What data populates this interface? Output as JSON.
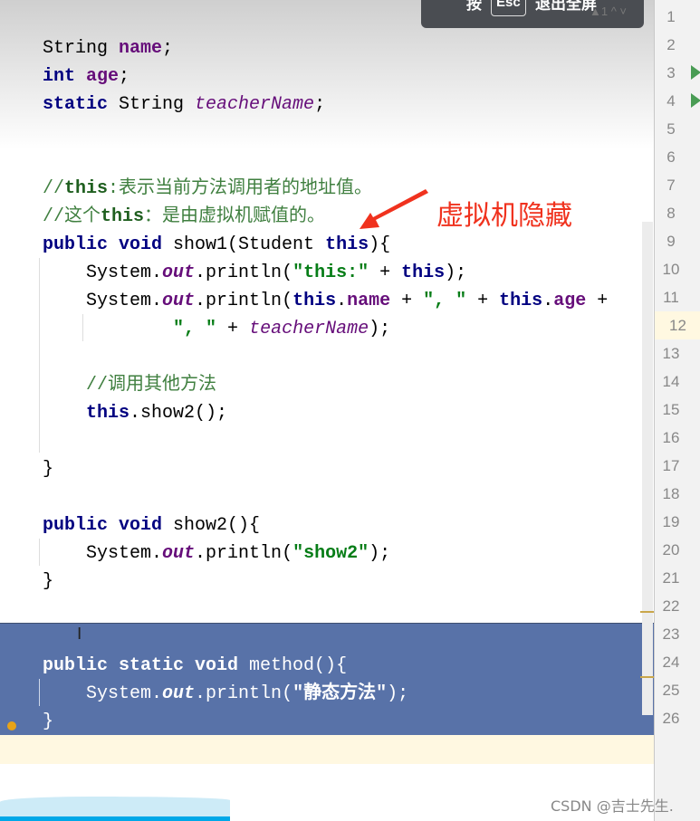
{
  "toast": {
    "prefix": "按",
    "key": "Esc",
    "suffix": "退出全屏",
    "warning_count": "▲1 ^ ˅"
  },
  "annotation": "虚拟机隐藏",
  "watermark": "CSDN @吉士先生.",
  "current_line": 12,
  "line_numbers": [
    "1",
    "2",
    "3",
    "4",
    "5",
    "6",
    "7",
    "8",
    "9",
    "10",
    "11",
    "12",
    "13",
    "14",
    "15",
    "16",
    "17",
    "18",
    "19",
    "20",
    "21",
    "22",
    "23",
    "24",
    "25",
    "26"
  ],
  "code_lines": [
    [
      [
        "String ",
        ""
      ],
      [
        "name",
        "fld"
      ],
      [
        ";",
        ""
      ]
    ],
    [
      [
        "int ",
        "kw"
      ],
      [
        "age",
        "fld"
      ],
      [
        ";",
        ""
      ]
    ],
    [
      [
        "static ",
        "kw"
      ],
      [
        "String ",
        ""
      ],
      [
        "teacherName",
        "sfld"
      ],
      [
        ";",
        ""
      ]
    ],
    [],
    [],
    [
      [
        "//",
        "cmt"
      ],
      [
        "this",
        "cmtb"
      ],
      [
        ":表示当前方法调用者的地址值。",
        "cmt"
      ]
    ],
    [
      [
        "//这个",
        "cmt"
      ],
      [
        "this",
        "cmtb"
      ],
      [
        "：是由虚拟机赋值的。",
        "cmt"
      ]
    ],
    [
      [
        "public void ",
        "kw"
      ],
      [
        "show1(Student ",
        ""
      ],
      [
        "this",
        "kw"
      ],
      [
        "){",
        ""
      ]
    ],
    [
      [
        "    System.",
        ""
      ],
      [
        "out",
        "ital"
      ],
      [
        ".println(",
        ""
      ],
      [
        "\"this:\"",
        "str"
      ],
      [
        " + ",
        ""
      ],
      [
        "this",
        "kw"
      ],
      [
        ");",
        ""
      ]
    ],
    [
      [
        "    System.",
        ""
      ],
      [
        "out",
        "ital"
      ],
      [
        ".println(",
        ""
      ],
      [
        "this",
        "kw"
      ],
      [
        ".",
        ""
      ],
      [
        "name",
        "fld"
      ],
      [
        " + ",
        ""
      ],
      [
        "\", \"",
        "str"
      ],
      [
        " + ",
        ""
      ],
      [
        "this",
        "kw"
      ],
      [
        ".",
        ""
      ],
      [
        "age",
        "fld"
      ],
      [
        " +",
        ""
      ]
    ],
    [
      [
        "            ",
        ""
      ],
      [
        "\", \"",
        "str"
      ],
      [
        " + ",
        ""
      ],
      [
        "teacherName",
        "sfld"
      ],
      [
        ");",
        ""
      ]
    ],
    [],
    [
      [
        "    ",
        ""
      ],
      [
        "//调用其他方法",
        "cmt"
      ]
    ],
    [
      [
        "    ",
        ""
      ],
      [
        "this",
        "kw"
      ],
      [
        ".show2();",
        ""
      ]
    ],
    [],
    [
      [
        "}",
        ""
      ]
    ],
    [],
    [
      [
        "public void ",
        "kw"
      ],
      [
        "show2(){",
        ""
      ]
    ],
    [
      [
        "    System.",
        ""
      ],
      [
        "out",
        "ital"
      ],
      [
        ".println(",
        ""
      ],
      [
        "\"show2\"",
        "str"
      ],
      [
        ");",
        ""
      ]
    ],
    [
      [
        "}",
        ""
      ]
    ],
    [],
    [],
    [
      [
        "public static void ",
        "kw"
      ],
      [
        "method(){",
        ""
      ]
    ],
    [
      [
        "    System.",
        ""
      ],
      [
        "out",
        "ital"
      ],
      [
        ".println(",
        ""
      ],
      [
        "\"静态方法\"",
        "str"
      ],
      [
        ");",
        ""
      ]
    ],
    [
      [
        "}",
        ""
      ]
    ]
  ],
  "selected_from_line": 21
}
